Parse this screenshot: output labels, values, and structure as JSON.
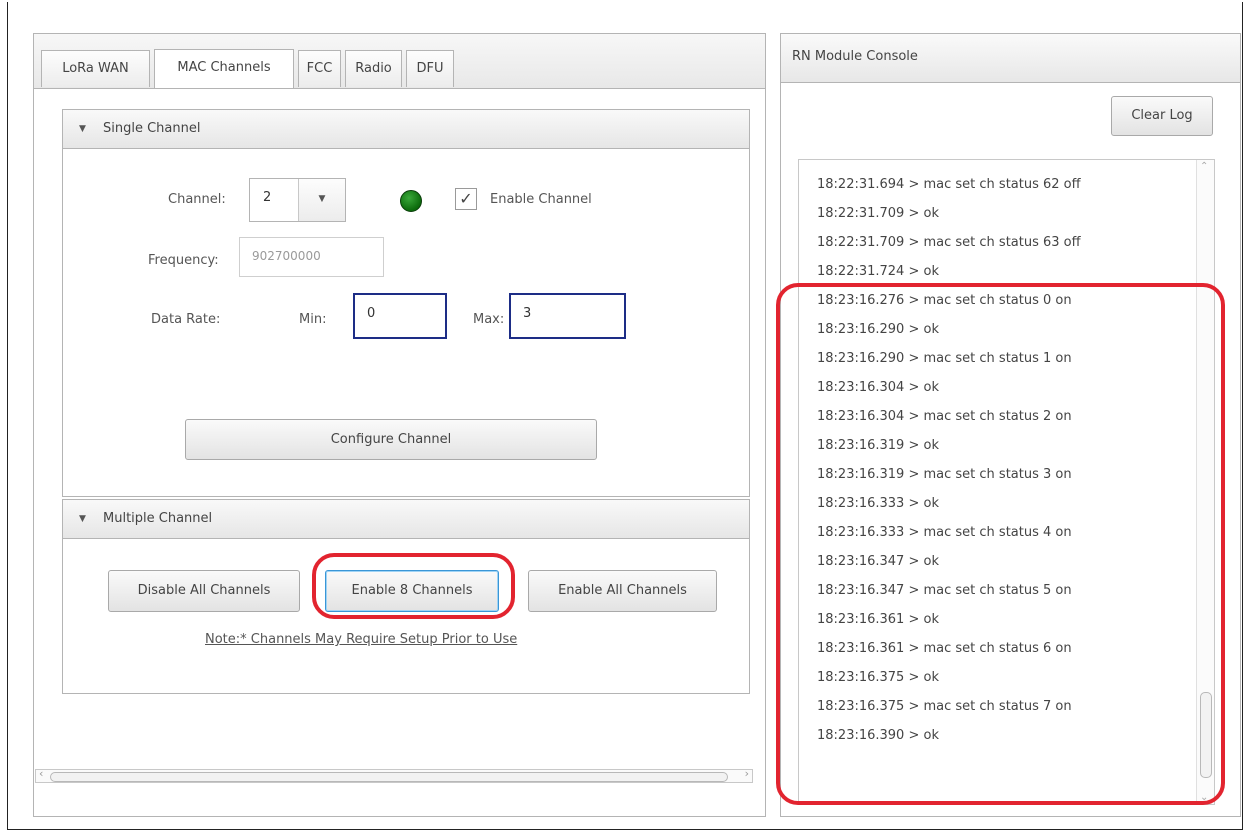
{
  "tabs": [
    "LoRa WAN",
    "MAC Channels",
    "FCC",
    "Radio",
    "DFU"
  ],
  "active_tab": "MAC Channels",
  "single_channel": {
    "header": "Single Channel",
    "channel_label": "Channel:",
    "channel_value": "2",
    "enable_label": "Enable Channel",
    "enable_checked": true,
    "status_led_color": "#0f7a0f",
    "frequency_label": "Frequency:",
    "frequency_value": "902700000",
    "data_rate_label": "Data Rate:",
    "min_label": "Min:",
    "min_value": "0",
    "max_label": "Max:",
    "max_value": "3",
    "configure_button": "Configure Channel"
  },
  "multiple_channel": {
    "header": "Multiple Channel",
    "disable_all_button": "Disable All Channels",
    "enable_8_button": "Enable 8 Channels",
    "enable_all_button": "Enable All Channels",
    "note": "Note:*  Channels May Require Setup Prior to Use"
  },
  "console": {
    "title": "RN Module Console",
    "clear_button": "Clear Log",
    "log_lines": [
      "18:22:31.694 > mac set ch status 62 off",
      "18:22:31.709 > ok",
      "18:22:31.709 > mac set ch status 63 off",
      "18:22:31.724 > ok",
      "18:23:16.276 > mac set ch status 0 on",
      "18:23:16.290 > ok",
      "18:23:16.290 > mac set ch status 1 on",
      "18:23:16.304 > ok",
      "18:23:16.304 > mac set ch status 2 on",
      "18:23:16.319 > ok",
      "18:23:16.319 > mac set ch status 3 on",
      "18:23:16.333 > ok",
      "18:23:16.333 > mac set ch status 4 on",
      "18:23:16.347 > ok",
      "18:23:16.347 > mac set ch status 5 on",
      "18:23:16.361 > ok",
      "18:23:16.361 > mac set ch status 6 on",
      "18:23:16.375 > ok",
      "18:23:16.375 > mac set ch status 7 on",
      "18:23:16.390 > ok"
    ]
  },
  "annotation_color": "#e2242f"
}
